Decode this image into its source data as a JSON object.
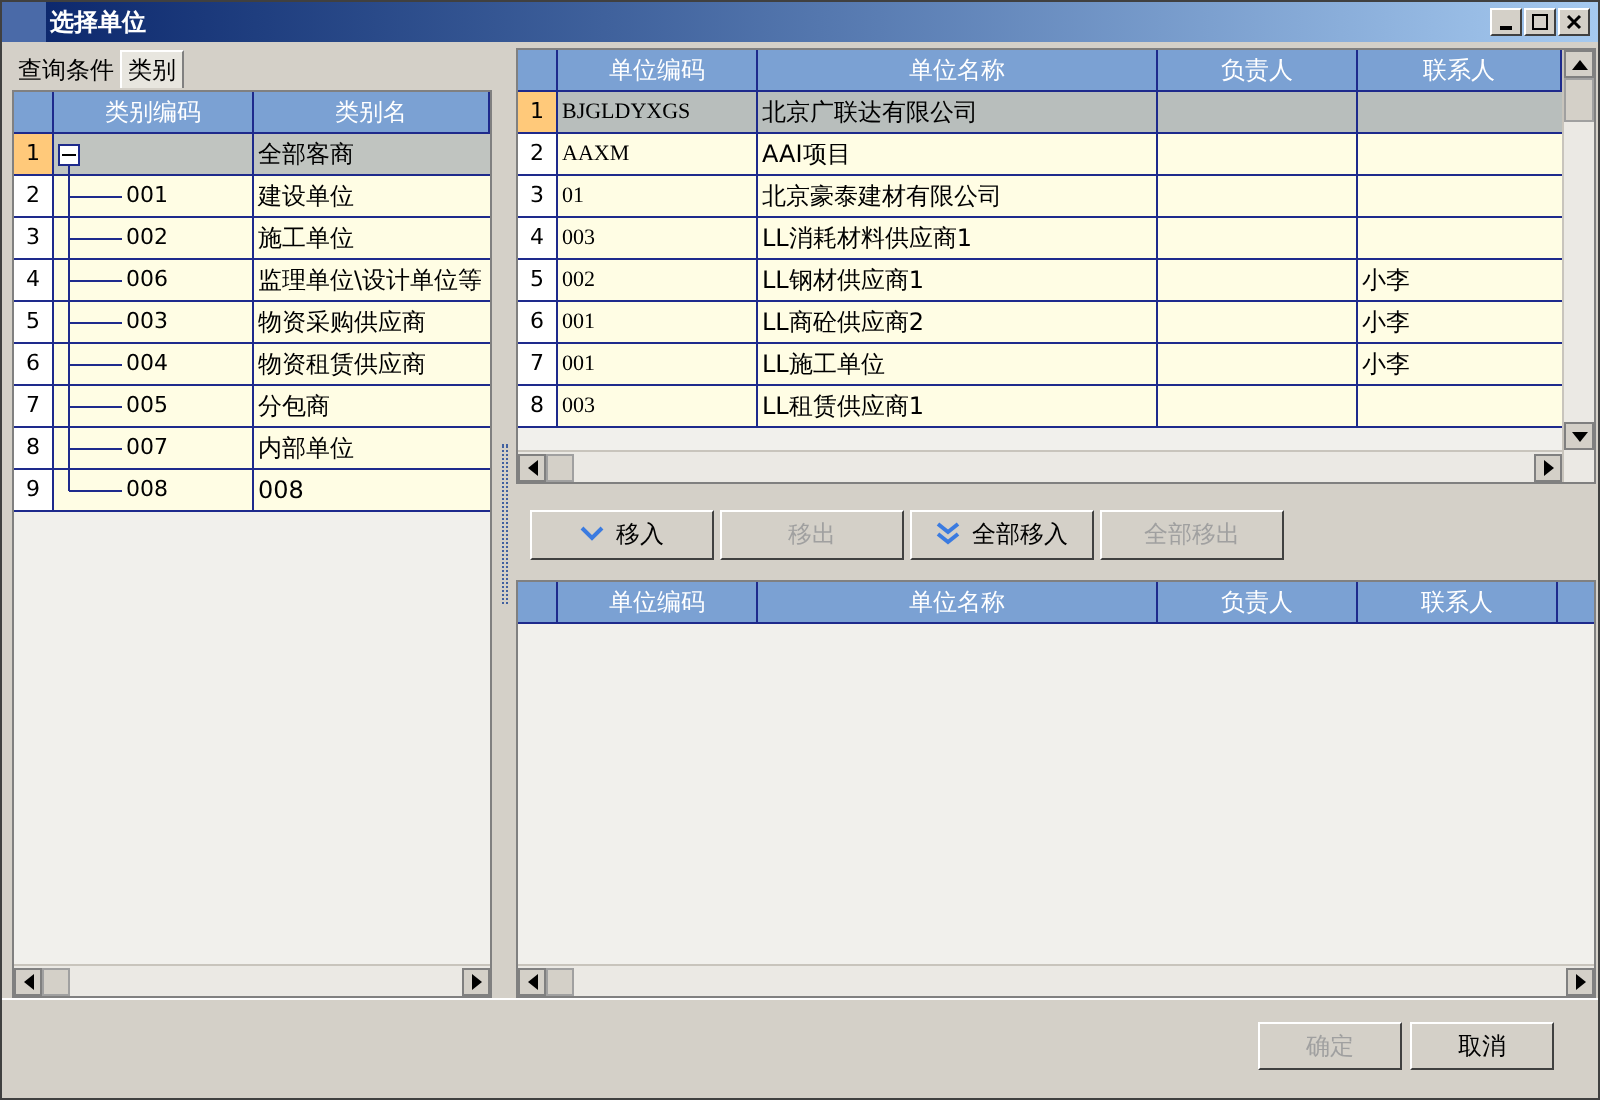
{
  "window": {
    "title": "选择单位"
  },
  "tabs": [
    {
      "label": "查询条件",
      "selected": false
    },
    {
      "label": "类别",
      "selected": true
    }
  ],
  "category_grid": {
    "columns": [
      "类别编码",
      "类别名"
    ],
    "root": {
      "row": "1",
      "name": "全部客商",
      "expanded": true,
      "selected": true,
      "children": [
        {
          "row": "2",
          "code": "001",
          "name": "建设单位",
          "selected": false
        },
        {
          "row": "3",
          "code": "002",
          "name": "施工单位",
          "selected": false
        },
        {
          "row": "4",
          "code": "006",
          "name": "监理单位\\设计单位等",
          "selected": false
        },
        {
          "row": "5",
          "code": "003",
          "name": "物资采购供应商",
          "selected": false
        },
        {
          "row": "6",
          "code": "004",
          "name": "物资租赁供应商",
          "selected": false
        },
        {
          "row": "7",
          "code": "005",
          "name": "分包商",
          "selected": false
        },
        {
          "row": "8",
          "code": "007",
          "name": "内部单位",
          "selected": false
        },
        {
          "row": "9",
          "code": "008",
          "name": "008",
          "selected": false
        }
      ]
    }
  },
  "available_grid": {
    "columns": [
      "单位编码",
      "单位名称",
      "负责人",
      "联系人"
    ],
    "rows": [
      {
        "row": "1",
        "code": "BJGLDYXGS",
        "name": "北京广联达有限公司",
        "selected": true
      },
      {
        "row": "2",
        "code": "AAXM",
        "name": "AAI项目",
        "selected": false
      },
      {
        "row": "3",
        "code": "01",
        "name": "北京豪泰建材有限公司",
        "selected": false
      },
      {
        "row": "4",
        "code": "003",
        "name": "LL消耗材料供应商1",
        "selected": false
      },
      {
        "row": "5",
        "code": "002",
        "name": "LL钢材供应商1",
        "contact": "小李",
        "selected": false
      },
      {
        "row": "6",
        "code": "001",
        "name": "LL商砼供应商2",
        "contact": "小李",
        "selected": false
      },
      {
        "row": "7",
        "code": "001",
        "name": "LL施工单位",
        "contact": "小李",
        "selected": false
      },
      {
        "row": "8",
        "code": "003",
        "name": "LL租赁供应商1",
        "selected": false
      }
    ]
  },
  "move_buttons": [
    {
      "label": "移入",
      "kind": "single",
      "disabled": false
    },
    {
      "label": "移出",
      "kind": "plain",
      "disabled": true
    },
    {
      "label": "全部移入",
      "kind": "double",
      "disabled": false
    },
    {
      "label": "全部移出",
      "kind": "plain",
      "disabled": true
    }
  ],
  "selected_grid": {
    "columns": [
      "单位编码",
      "单位名称",
      "负责人",
      "联系人"
    ]
  },
  "footer_buttons": [
    {
      "label": "确定",
      "disabled": true
    },
    {
      "label": "取消",
      "disabled": false
    }
  ]
}
